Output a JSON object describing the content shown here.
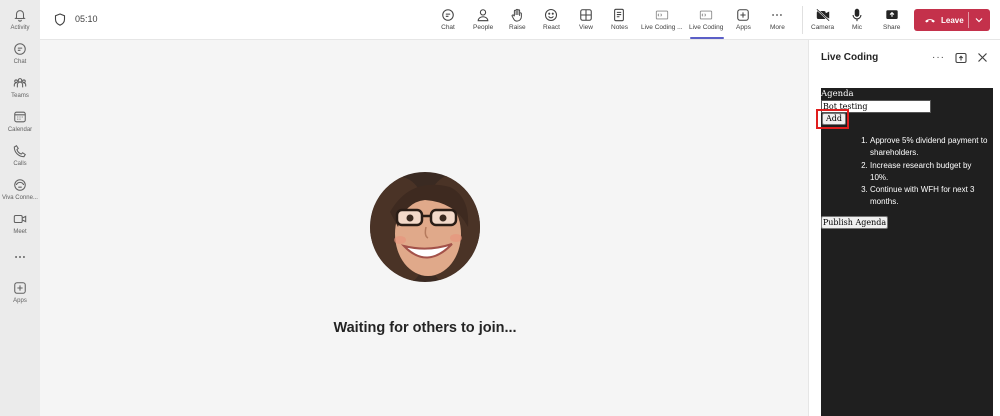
{
  "rail": {
    "items": [
      {
        "label": "Activity",
        "icon": "bell-icon"
      },
      {
        "label": "Chat",
        "icon": "chat-icon"
      },
      {
        "label": "Teams",
        "icon": "teams-icon"
      },
      {
        "label": "Calendar",
        "icon": "calendar-icon"
      },
      {
        "label": "Calls",
        "icon": "phone-icon"
      },
      {
        "label": "Viva Conne...",
        "icon": "viva-connections-icon"
      },
      {
        "label": "Meet",
        "icon": "video-icon"
      },
      {
        "label": "",
        "icon": "more-icon"
      },
      {
        "label": "Apps",
        "icon": "apps-icon"
      }
    ]
  },
  "topbar": {
    "timer": "05:10",
    "tools": [
      {
        "label": "Chat",
        "icon": "chat-icon"
      },
      {
        "label": "People",
        "icon": "people-icon"
      },
      {
        "label": "Raise",
        "icon": "raise-hand-icon"
      },
      {
        "label": "React",
        "icon": "emoji-icon"
      },
      {
        "label": "View",
        "icon": "grid-view-icon"
      },
      {
        "label": "Notes",
        "icon": "notes-icon"
      },
      {
        "label": "Live Coding ...",
        "icon": "live-coding-icon"
      },
      {
        "label": "Live Coding",
        "icon": "live-coding-icon"
      },
      {
        "label": "Apps",
        "icon": "add-apps-icon"
      },
      {
        "label": "More",
        "icon": "more-icon"
      },
      {
        "label": "Camera",
        "icon": "camera-off-icon"
      },
      {
        "label": "Mic",
        "icon": "mic-icon"
      },
      {
        "label": "Share",
        "icon": "share-icon"
      }
    ],
    "leave_label": "Leave"
  },
  "stage": {
    "waiting_text": "Waiting for others to join..."
  },
  "panel": {
    "title": "Live Coding",
    "more": "···",
    "agenda_label": "Agenda",
    "agenda_input_value": "Bot testing",
    "add_label": "Add",
    "items": [
      "Approve 5% dividend payment to shareholders.",
      "Increase research budget by 10%.",
      "Continue with WFH for next 3 months."
    ],
    "publish_label": "Publish Agenda"
  },
  "colors": {
    "accent": "#5b5fc7",
    "leave": "#c4314b",
    "app_bg": "#1f1f1f",
    "highlight": "#e01e1e"
  }
}
